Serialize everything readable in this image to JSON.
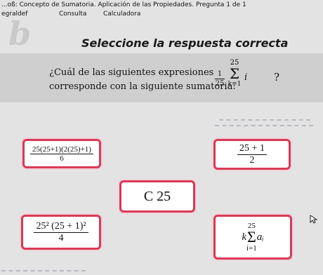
{
  "window": {
    "title": "...oß: Concepto de Sumatoria. Aplicación de las Propiedades. Pregunta 1 de 1"
  },
  "menubar": {
    "user": "egraldef",
    "items": [
      "Consulta",
      "Calculadora"
    ]
  },
  "logo": "b",
  "heading": "Seleccione la respuesta correcta",
  "question": {
    "line1": "¿Cuál de las siguientes expresiones",
    "line2": "corresponde con la siguiente sumatoria:",
    "formula": {
      "coef_num": "1",
      "coef_den": "25",
      "upper": "25",
      "sigma": "Σ",
      "lower": "k=1",
      "var": "i",
      "qmark": "?"
    }
  },
  "options": {
    "a": {
      "num": "25(25+1)(2(25)+1)",
      "den": "6"
    },
    "b": {
      "num": "25 + 1",
      "den": "2"
    },
    "c": {
      "text": "C 25"
    },
    "d": {
      "num": "25² (25 + 1)²",
      "den": "4"
    },
    "e": {
      "coef": "k",
      "upper": "25",
      "sigma": "Σ",
      "lower": "i=1",
      "term": "aᵢ"
    }
  },
  "colors": {
    "accent_border": "#d93a57",
    "background": "#e3e3e3",
    "question_band": "#cfcfcf"
  }
}
